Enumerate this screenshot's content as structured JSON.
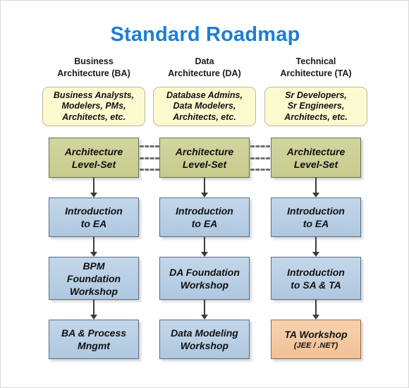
{
  "title": "Standard Roadmap",
  "theme": {
    "title_color": "#1b7fd4",
    "role_box_fill": "#fdfacf",
    "level_set_fill": "#cbcf96",
    "course_fill": "#b8cee3",
    "ta_workshop_fill": "#f5c9a0",
    "connector_color": "#3b3b3b"
  },
  "columns": [
    {
      "id": "ba",
      "header_line1": "Business",
      "header_line2": "Architecture (BA)",
      "roles": [
        "Business Analysts,",
        "Modelers, PMs,",
        "Architects, etc."
      ],
      "steps": [
        {
          "kind": "level-set",
          "lines": [
            "Architecture",
            "Level-Set"
          ],
          "sub": ""
        },
        {
          "kind": "course",
          "lines": [
            "Introduction",
            "to EA"
          ],
          "sub": ""
        },
        {
          "kind": "course",
          "lines": [
            "BPM",
            "Foundation",
            "Workshop"
          ],
          "sub": ""
        },
        {
          "kind": "course",
          "lines": [
            "BA & Process",
            "Mngmt"
          ],
          "sub": ""
        }
      ]
    },
    {
      "id": "da",
      "header_line1": "Data",
      "header_line2": "Architecture (DA)",
      "roles": [
        "Database Admins,",
        "Data Modelers,",
        "Architects, etc."
      ],
      "steps": [
        {
          "kind": "level-set",
          "lines": [
            "Architecture",
            "Level-Set"
          ],
          "sub": ""
        },
        {
          "kind": "course",
          "lines": [
            "Introduction",
            "to EA"
          ],
          "sub": ""
        },
        {
          "kind": "course",
          "lines": [
            "DA Foundation",
            "Workshop"
          ],
          "sub": ""
        },
        {
          "kind": "course",
          "lines": [
            "Data Modeling",
            "Workshop"
          ],
          "sub": ""
        }
      ]
    },
    {
      "id": "ta",
      "header_line1": "Technical",
      "header_line2": "Architecture (TA)",
      "roles": [
        "Sr Developers,",
        "Sr Engineers,",
        "Architects, etc."
      ],
      "steps": [
        {
          "kind": "level-set",
          "lines": [
            "Architecture",
            "Level-Set"
          ],
          "sub": ""
        },
        {
          "kind": "course",
          "lines": [
            "Introduction",
            "to EA"
          ],
          "sub": ""
        },
        {
          "kind": "course",
          "lines": [
            "Introduction",
            "to SA & TA"
          ],
          "sub": ""
        },
        {
          "kind": "ta-workshop",
          "lines": [
            "TA Workshop"
          ],
          "sub": "(JEE / .NET)"
        }
      ]
    }
  ],
  "cross_links": {
    "count_per_gap": 3,
    "style": "dashed",
    "description": "Architecture Level-Set boxes are linked across all three tracks"
  }
}
